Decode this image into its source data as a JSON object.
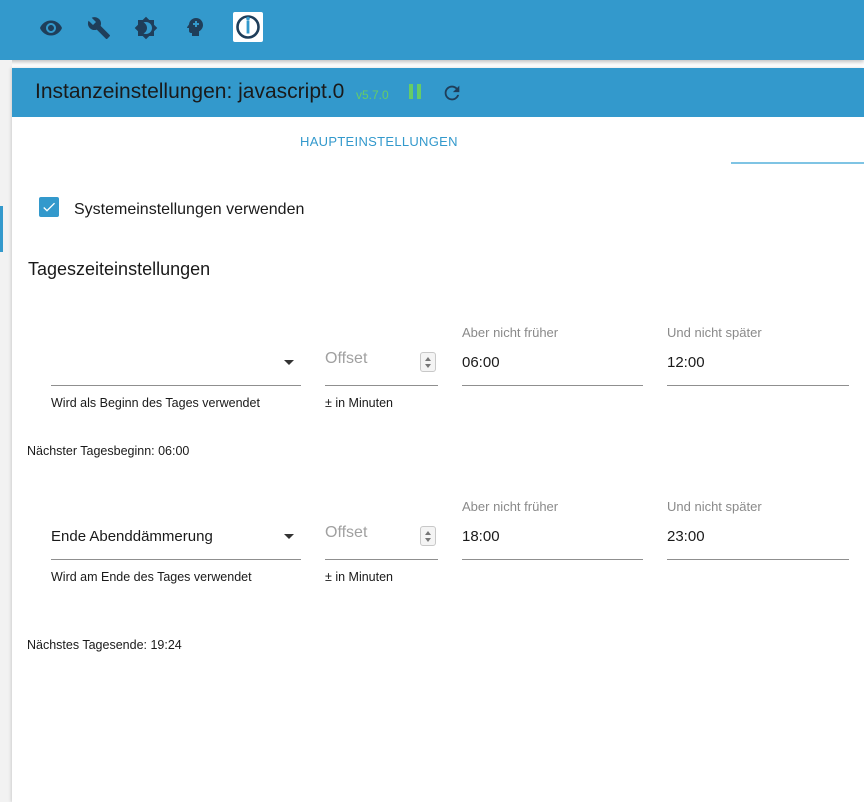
{
  "toolbar": {
    "icons": [
      "eye-icon",
      "wrench-icon",
      "brightness-icon",
      "head-icon",
      "iobroker-logo"
    ]
  },
  "instance": {
    "title": "Instanzeinstellungen: javascript.0",
    "version": "v5.7.0"
  },
  "tabs": [
    {
      "label": "HAUPTEINSTELLUNGEN"
    }
  ],
  "settings": {
    "use_system_settings_label": "Systemeinstellungen verwenden",
    "use_system_settings_checked": true
  },
  "daytime": {
    "section_title": "Tageszeiteinstellungen",
    "start": {
      "selected": "",
      "select_helper": "Wird als Beginn des Tages verwendet",
      "offset_placeholder": "Offset",
      "offset_helper": "± in Minuten",
      "not_before_label": "Aber nicht früher",
      "not_before_value": "06:00",
      "not_after_label": "Und nicht später",
      "not_after_value": "12:00",
      "next_info": "Nächster Tagesbeginn: 06:00"
    },
    "end": {
      "selected": "Ende Abenddämmerung",
      "select_helper": "Wird am Ende des Tages verwendet",
      "offset_placeholder": "Offset",
      "offset_helper": "± in Minuten",
      "not_before_label": "Aber nicht früher",
      "not_before_value": "18:00",
      "not_after_label": "Und nicht später",
      "not_after_value": "23:00",
      "next_info": "Nächstes Tagesende: 19:24"
    }
  },
  "colors": {
    "accent": "#3399cc",
    "icon_dark": "#1f3e5a",
    "status_green": "#66cc66"
  }
}
